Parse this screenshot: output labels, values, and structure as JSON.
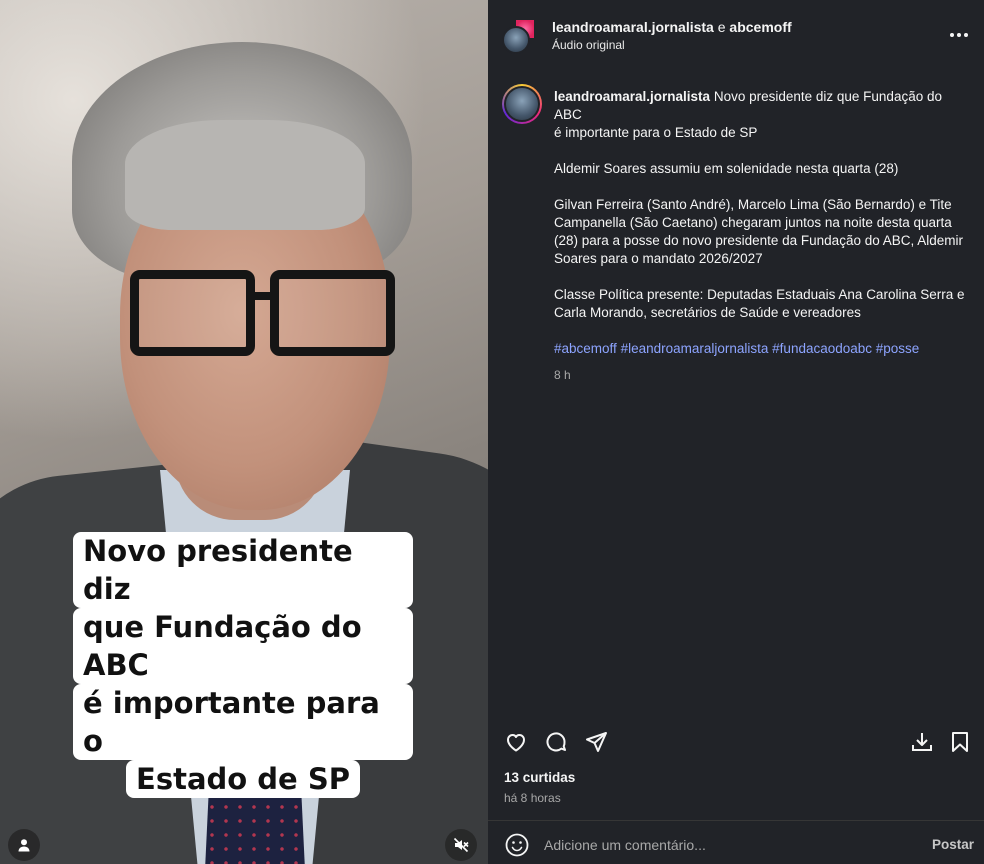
{
  "video": {
    "caption_lines": [
      "Novo presidente diz",
      "que Fundação do ABC",
      "é importante para o",
      "Estado de SP"
    ]
  },
  "header": {
    "author": "leandroamaral.jornalista",
    "connector": "e",
    "coauthor": "abcemoff",
    "audio": "Áudio original"
  },
  "post": {
    "author": "leandroamaral.jornalista",
    "lines": [
      "Novo presidente diz que Fundação do ABC",
      "é importante para o Estado de SP",
      "Aldemir Soares assumiu em solenidade nesta quarta (28)",
      "Gilvan Ferreira (Santo André), Marcelo Lima (São Bernardo) e Tite Campanella (São Caetano) chegaram juntos na noite desta quarta (28) para a posse do novo presidente da Fundação do ABC, Aldemir Soares para o mandato 2026/2027",
      "Classe Política presente: Deputadas Estaduais Ana Carolina Serra e Carla Morando, secretários de Saúde e vereadores"
    ],
    "hashtags": [
      "#abcemoff",
      "#leandroamaraljornalista",
      "#fundacaodoabc",
      "#posse"
    ],
    "time": "8 h"
  },
  "stats": {
    "likes": "13 curtidas",
    "ago": "há 8 horas"
  },
  "comment": {
    "placeholder": "Adicione um comentário...",
    "submit_label": "Postar"
  },
  "icons": {
    "like": "heart-icon",
    "comment": "comment-icon",
    "share": "send-icon",
    "download": "download-icon",
    "save": "bookmark-icon",
    "more": "more-icon",
    "mute": "muted-speaker-icon",
    "tagged": "user-icon",
    "emoji": "emoji-icon"
  },
  "colors": {
    "panel_bg": "#212328",
    "hashtag": "#8da4ff",
    "muted_text": "#a8a8a8"
  }
}
